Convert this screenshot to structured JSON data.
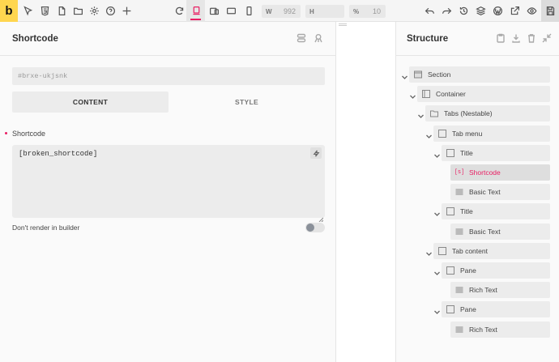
{
  "app": {
    "logo_letter": "b"
  },
  "toolbar": {
    "left_icons": [
      "cursor-icon",
      "html5-icon",
      "file-icon",
      "folder-icon",
      "gear-icon",
      "help-icon",
      "plus-icon"
    ],
    "breakpoint_icons": [
      "refresh-icon",
      "desktop-icon",
      "tablet-landscape-icon",
      "tablet-portrait-icon",
      "mobile-icon"
    ],
    "width": {
      "label": "W",
      "value": "992"
    },
    "height": {
      "label": "H",
      "value": ""
    },
    "zoom": {
      "label": "%",
      "value": "10"
    },
    "right_icons": [
      "undo-icon",
      "redo-icon",
      "history-icon",
      "layers-icon",
      "wordpress-icon",
      "external-link-icon",
      "eye-icon",
      "save-icon"
    ]
  },
  "left_panel": {
    "title": "Shortcode",
    "element_id": "#brxe-ukjsnk",
    "tabs": [
      "CONTENT",
      "STYLE"
    ],
    "field_label": "Shortcode",
    "field_value": "[broken_shortcode]",
    "toggle_label": "Don't render in builder"
  },
  "structure": {
    "title": "Structure",
    "nodes": [
      {
        "label": "Section",
        "icon": "section-icon"
      },
      {
        "label": "Container",
        "icon": "container-icon"
      },
      {
        "label": "Tabs (Nestable)",
        "icon": "folder-icon"
      },
      {
        "label": "Tab menu",
        "icon": "box-icon"
      },
      {
        "label": "Title",
        "icon": "box-icon"
      },
      {
        "label": "Shortcode",
        "icon": "shortcode-icon",
        "selected": true
      },
      {
        "label": "Basic Text",
        "icon": "text-icon"
      },
      {
        "label": "Title",
        "icon": "box-icon"
      },
      {
        "label": "Basic Text",
        "icon": "text-icon"
      },
      {
        "label": "Tab content",
        "icon": "box-icon"
      },
      {
        "label": "Pane",
        "icon": "box-icon"
      },
      {
        "label": "Rich Text",
        "icon": "text-icon"
      },
      {
        "label": "Pane",
        "icon": "box-icon"
      },
      {
        "label": "Rich Text",
        "icon": "text-icon"
      }
    ]
  },
  "colors": {
    "accent": "#e91e63",
    "logo_bg": "#ffd64f"
  }
}
